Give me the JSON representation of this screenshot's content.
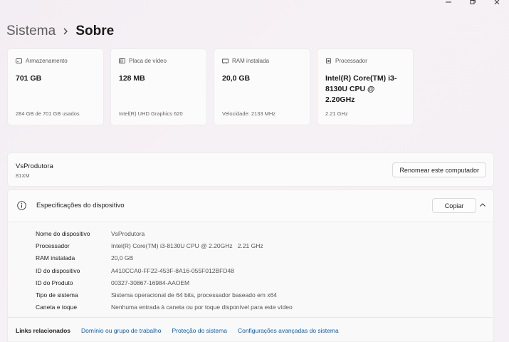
{
  "breadcrumb": {
    "parent": "Sistema",
    "current": "Sobre"
  },
  "cards": [
    {
      "icon": "storage-icon",
      "label": "Armazenamento",
      "value": "701 GB",
      "sub": "284 GB de 701 GB usados"
    },
    {
      "icon": "gpu-icon",
      "label": "Placa de vídeo",
      "value": "128 MB",
      "sub": "Intel(R) UHD Graphics 620"
    },
    {
      "icon": "ram-icon",
      "label": "RAM instalada",
      "value": "20,0 GB",
      "sub": "Velocidade: 2133 MHz"
    },
    {
      "icon": "cpu-icon",
      "label": "Processador",
      "value": "Intel(R) Core(TM) i3-8130U CPU @ 2.20GHz",
      "sub": "2.21 GHz"
    }
  ],
  "device": {
    "name": "VsProdutora",
    "model": "81XM",
    "rename_label": "Renomear este computador"
  },
  "specs": {
    "title": "Especificações do dispositivo",
    "copy_label": "Copiar",
    "rows": [
      {
        "label": "Nome do dispositivo",
        "value": "VsProdutora"
      },
      {
        "label": "Processador",
        "value": "Intel(R) Core(TM) i3-8130U CPU @ 2.20GHz   2.21 GHz"
      },
      {
        "label": "RAM instalada",
        "value": "20,0 GB"
      },
      {
        "label": "ID do dispositivo",
        "value": "A410CCA0-FF22-453F-8A16-055F012BFD48"
      },
      {
        "label": "ID do Produto",
        "value": "00327-30867-16984-AAOEM"
      },
      {
        "label": "Tipo de sistema",
        "value": "Sistema operacional de 64 bits, processador baseado em x64"
      },
      {
        "label": "Caneta e toque",
        "value": "Nenhuma entrada à caneta ou por toque disponível para este vídeo"
      }
    ]
  },
  "related": {
    "label": "Links relacionados",
    "links": [
      "Domínio ou grupo de trabalho",
      "Proteção do sistema",
      "Configurações avançadas do sistema"
    ]
  },
  "colors": {
    "link": "#0a5fb4",
    "card_bg": "#fbfbfb"
  }
}
